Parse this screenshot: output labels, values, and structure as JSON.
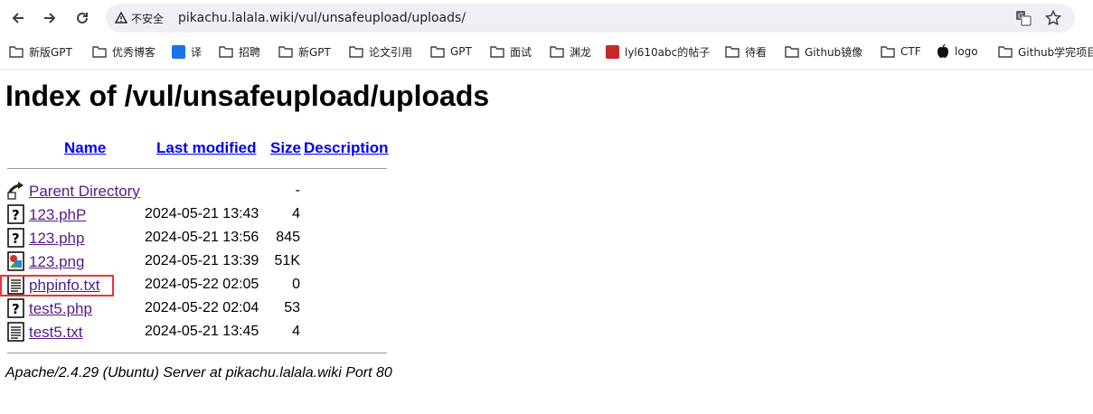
{
  "browser": {
    "security_label": "不安全",
    "url": "pikachu.lalala.wiki/vul/unsafeupload/uploads/",
    "bookmarks": [
      {
        "label": "新版GPT",
        "icon": "folder-icon"
      },
      {
        "label": "优秀博客",
        "icon": "folder-icon"
      },
      {
        "label": "译",
        "icon": "translate-badge-icon"
      },
      {
        "label": "招聘",
        "icon": "folder-icon"
      },
      {
        "label": "新GPT",
        "icon": "folder-icon"
      },
      {
        "label": "论文引用",
        "icon": "folder-icon"
      },
      {
        "label": "GPT",
        "icon": "folder-icon"
      },
      {
        "label": "面试",
        "icon": "folder-icon"
      },
      {
        "label": "渊龙",
        "icon": "folder-icon"
      },
      {
        "label": "lyl610abc的帖子",
        "icon": "red-site-icon"
      },
      {
        "label": "待看",
        "icon": "folder-icon"
      },
      {
        "label": "Github镜像",
        "icon": "folder-icon"
      },
      {
        "label": "CTF",
        "icon": "folder-icon"
      },
      {
        "label": "logo",
        "icon": "apple-icon"
      },
      {
        "label": "Github学完项目",
        "icon": "folder-icon"
      }
    ]
  },
  "listing": {
    "title": "Index of /vul/unsafeupload/uploads",
    "columns": {
      "name": "Name",
      "last_modified": "Last modified",
      "size": "Size",
      "description": "Description"
    },
    "rows": [
      {
        "name": "Parent Directory",
        "date": "",
        "size": "-",
        "icon": "parent-directory-icon"
      },
      {
        "name": "123.phP",
        "date": "2024-05-21 13:43",
        "size": "4",
        "icon": "unknown-file-icon"
      },
      {
        "name": "123.php",
        "date": "2024-05-21 13:56",
        "size": "845",
        "icon": "unknown-file-icon"
      },
      {
        "name": "123.png",
        "date": "2024-05-21 13:39",
        "size": "51K",
        "icon": "image-file-icon"
      },
      {
        "name": "phpinfo.txt",
        "date": "2024-05-22 02:05",
        "size": "0",
        "icon": "text-file-icon"
      },
      {
        "name": "test5.php",
        "date": "2024-05-22 02:04",
        "size": "53",
        "icon": "unknown-file-icon"
      },
      {
        "name": "test5.txt",
        "date": "2024-05-21 13:45",
        "size": "4",
        "icon": "text-file-icon"
      }
    ],
    "footer": "Apache/2.4.29 (Ubuntu) Server at pikachu.lalala.wiki Port 80"
  },
  "colors": {
    "link": "#0000ee",
    "visited": "#551a8b",
    "highlight": "#e33333"
  }
}
